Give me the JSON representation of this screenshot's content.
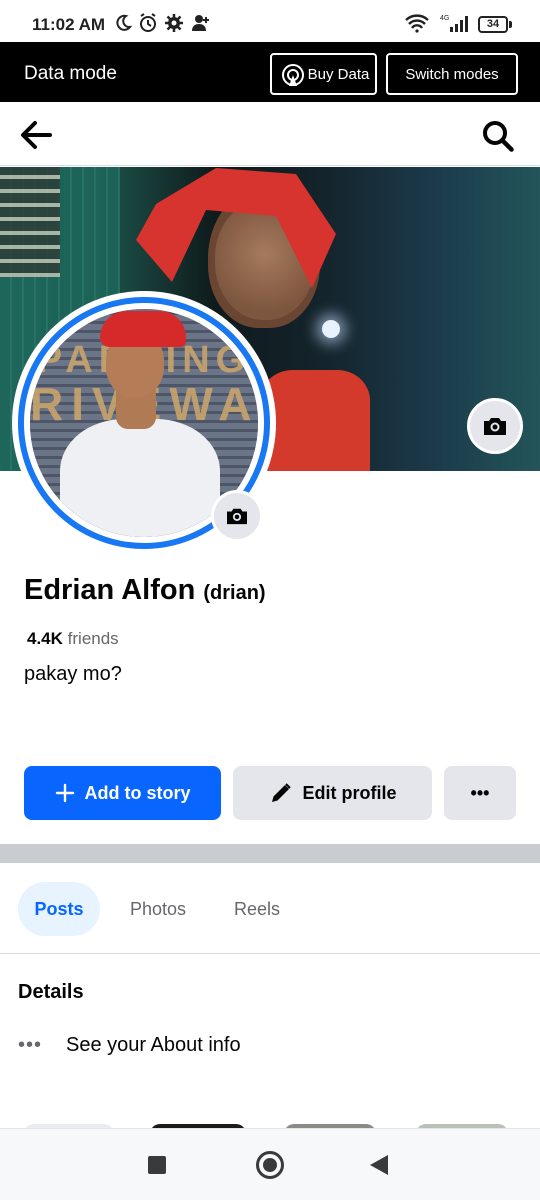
{
  "status_bar": {
    "time": "11:02 AM",
    "battery": "34",
    "icons": [
      "moon-icon",
      "alarm-icon",
      "gear-icon",
      "person-add-icon",
      "wifi-icon",
      "signal-4g-icon",
      "battery-icon"
    ]
  },
  "data_mode_bar": {
    "title": "Data mode",
    "buy_data_label": "Buy Data",
    "switch_modes_label": "Switch modes"
  },
  "header": {
    "back_icon": "arrow-left-icon",
    "search_icon": "search-icon"
  },
  "profile": {
    "name": "Edrian Alfon",
    "alternate_name": "(drian)",
    "friends_count": "4.4K",
    "friends_label": "friends",
    "bio": "pakay mo?",
    "avatar_sign_line1": "PARKING",
    "avatar_sign_line2": "RIVEWAY"
  },
  "actions": {
    "add_to_story": "Add to story",
    "edit_profile": "Edit profile",
    "more": "•••"
  },
  "tabs": [
    {
      "label": "Posts",
      "active": true
    },
    {
      "label": "Photos",
      "active": false
    },
    {
      "label": "Reels",
      "active": false
    }
  ],
  "details": {
    "title": "Details",
    "about_dots": "•••",
    "about_label": "See your About info"
  },
  "colors": {
    "accent": "#0866ff",
    "avatar_ring": "#1877f2",
    "button_gray": "#e4e6eb",
    "tab_active_bg": "#e7f3ff"
  }
}
